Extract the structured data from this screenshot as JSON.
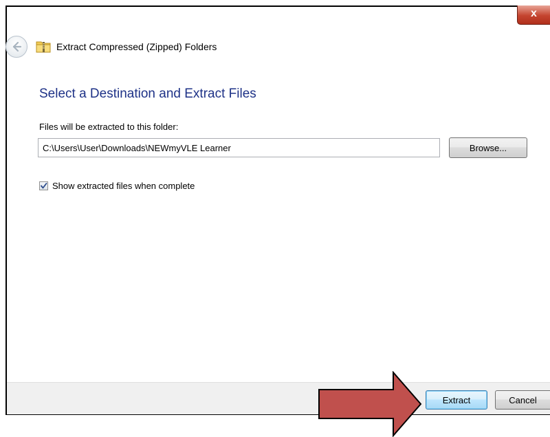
{
  "window": {
    "title": "Extract Compressed (Zipped) Folders",
    "close_label": "x"
  },
  "main": {
    "heading": "Select a Destination and Extract Files",
    "path_label": "Files will be extracted to this folder:",
    "path_value": "C:\\Users\\User\\Downloads\\NEWmyVLE Learner",
    "browse_label": "Browse...",
    "show_files_checked": true,
    "show_files_label": "Show extracted files when complete"
  },
  "footer": {
    "extract_label": "Extract",
    "cancel_label": "Cancel"
  },
  "icons": {
    "back": "back-arrow-icon",
    "folder": "zipped-folder-icon",
    "check": "checkmark-icon",
    "annotation": "red-arrow-annotation"
  },
  "colors": {
    "heading": "#1e3287",
    "close_button": "#c4442f",
    "annotation_arrow": "#c0504d"
  }
}
